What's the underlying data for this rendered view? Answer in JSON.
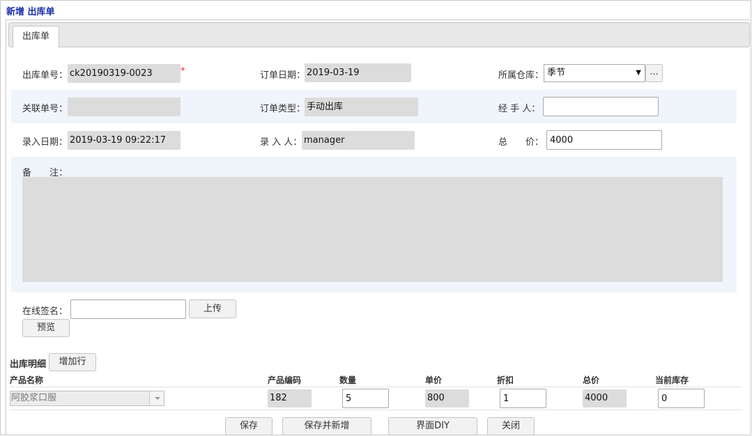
{
  "page": {
    "title": "新增 出库单"
  },
  "tabs": [
    {
      "label": "出库单"
    }
  ],
  "form": {
    "order_no": {
      "label": "出库单号：",
      "value": "ck20190319-0023",
      "required_mark": "*"
    },
    "order_date": {
      "label": "订单日期：",
      "value": "2019-03-19"
    },
    "warehouse": {
      "label": "所属仓库：",
      "value": "季节",
      "picker_label": "..."
    },
    "related_no": {
      "label": "关联单号：",
      "value": ""
    },
    "order_type": {
      "label": "订单类型：",
      "value": "手动出库"
    },
    "handler": {
      "label": "经 手 人：",
      "value": ""
    },
    "entry_date": {
      "label": "录入日期：",
      "value": "2019-03-19 09:22:17"
    },
    "entered_by": {
      "label": "录 入 人：",
      "value": "manager"
    },
    "total": {
      "label": "总　　价：",
      "value": "4000"
    },
    "remark": {
      "label": "备　　注：",
      "value": ""
    },
    "signature": {
      "label": "在线签名：",
      "value": "",
      "upload_label": "上传",
      "preview_label": "预览"
    }
  },
  "details": {
    "title": "出库明细",
    "add_row_label": "增加行",
    "columns": [
      "产品名称",
      "产品编码",
      "数量",
      "单价",
      "折扣",
      "总价",
      "当前库存"
    ],
    "rows": [
      {
        "product_name": "阿胶浆口服",
        "product_code": "182",
        "quantity": "5",
        "unit_price": "800",
        "discount": "1",
        "total": "4000",
        "stock": "0"
      }
    ]
  },
  "actions": {
    "save": "保存",
    "save_and_new": "保存并新增",
    "ui_diy": "界面DIY",
    "close": "关闭"
  },
  "colors": {
    "title_blue": "#1a2fa8",
    "stripe": "#f0f5fc",
    "readonly_bg": "#dcdcdc",
    "required_red": "#e23"
  }
}
